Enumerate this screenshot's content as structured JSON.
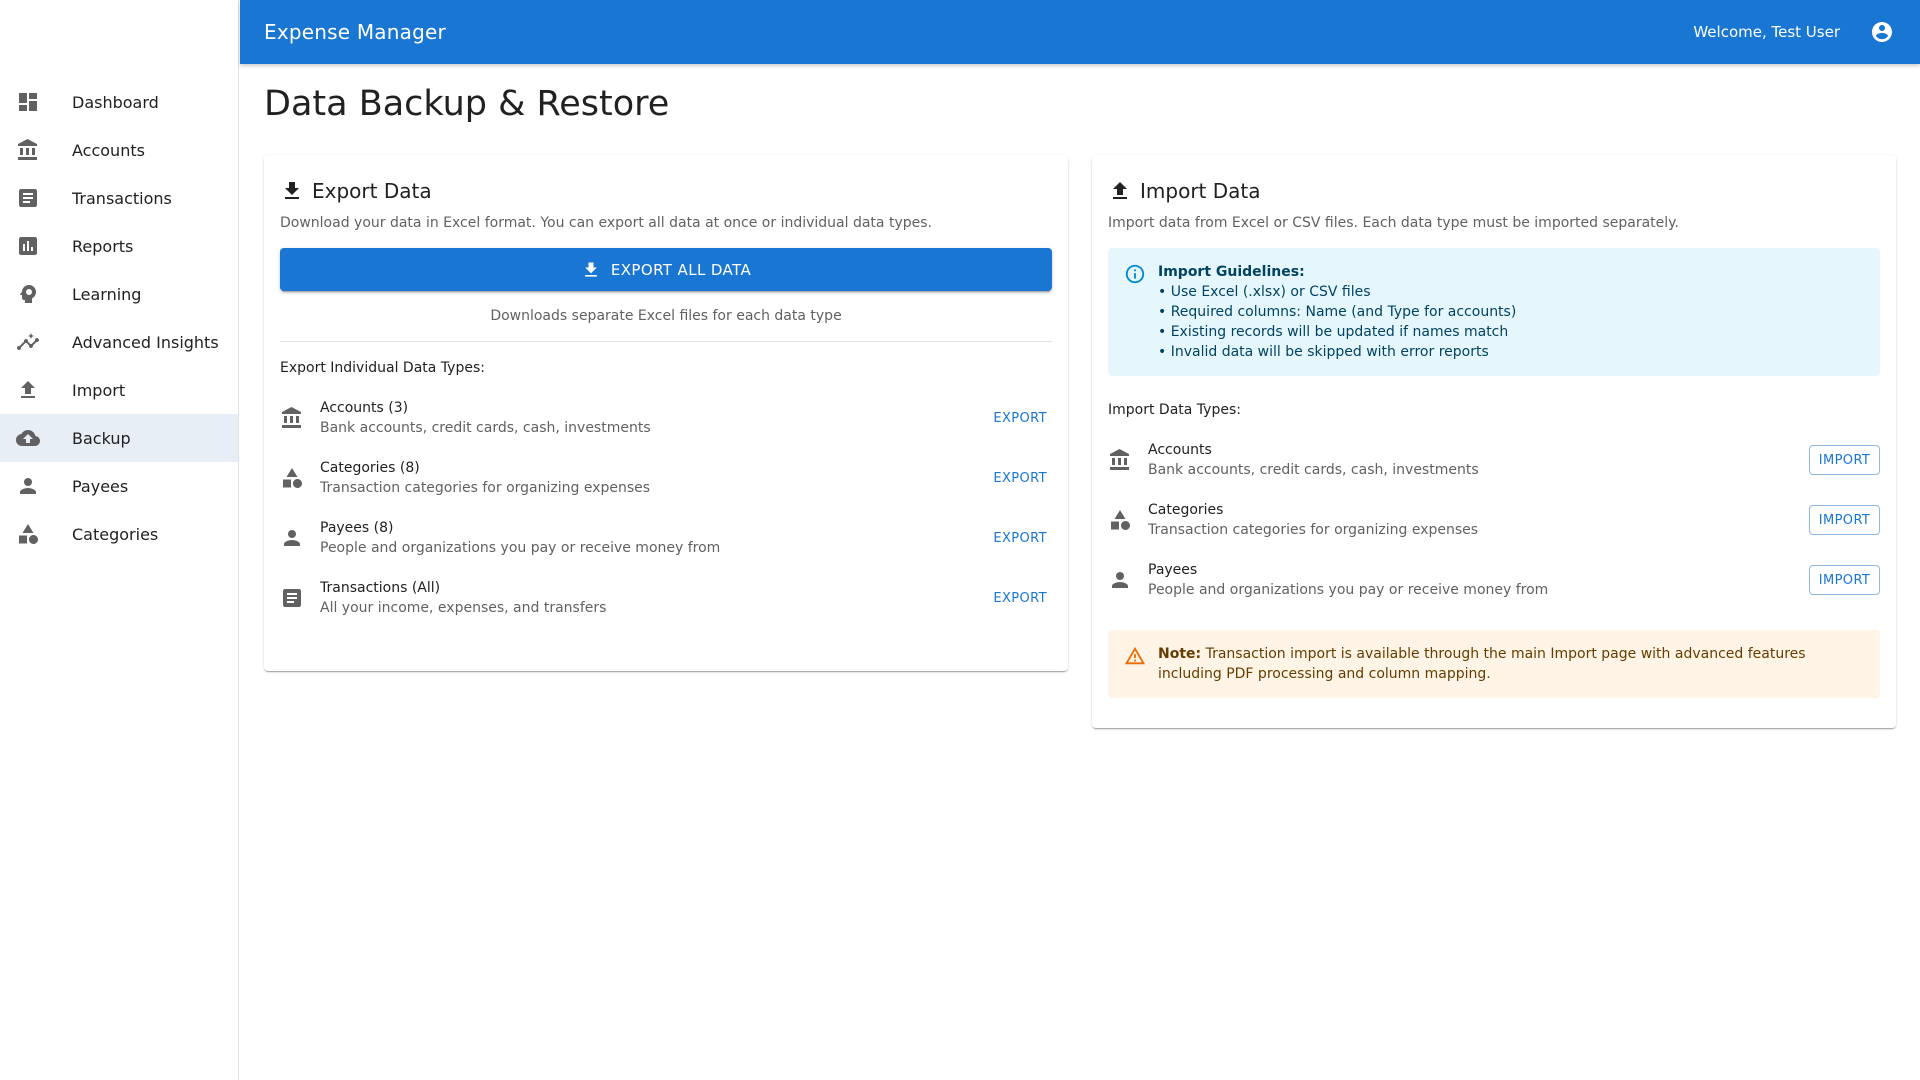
{
  "app": {
    "title": "Expense Manager",
    "welcome": "Welcome, Test User"
  },
  "sidebar": {
    "items": [
      {
        "label": "Dashboard",
        "icon": "dashboard-icon"
      },
      {
        "label": "Accounts",
        "icon": "bank-icon"
      },
      {
        "label": "Transactions",
        "icon": "receipt-icon"
      },
      {
        "label": "Reports",
        "icon": "assessment-icon"
      },
      {
        "label": "Learning",
        "icon": "psychology-icon"
      },
      {
        "label": "Advanced Insights",
        "icon": "insights-icon"
      },
      {
        "label": "Import",
        "icon": "upload-icon"
      },
      {
        "label": "Backup",
        "icon": "cloud-upload-icon",
        "selected": true
      },
      {
        "label": "Payees",
        "icon": "person-icon"
      },
      {
        "label": "Categories",
        "icon": "category-icon"
      }
    ]
  },
  "page": {
    "title": "Data Backup & Restore"
  },
  "export": {
    "title": "Export Data",
    "description": "Download your data in Excel format. You can export all data at once or individual data types.",
    "export_all_label": "EXPORT ALL DATA",
    "export_all_caption": "Downloads separate Excel files for each data type",
    "section_label": "Export Individual Data Types:",
    "button_label": "EXPORT",
    "items": [
      {
        "title": "Accounts (3)",
        "subtitle": "Bank accounts, credit cards, cash, investments",
        "icon": "bank-icon"
      },
      {
        "title": "Categories (8)",
        "subtitle": "Transaction categories for organizing expenses",
        "icon": "category-icon"
      },
      {
        "title": "Payees (8)",
        "subtitle": "People and organizations you pay or receive money from",
        "icon": "person-icon"
      },
      {
        "title": "Transactions (All)",
        "subtitle": "All your income, expenses, and transfers",
        "icon": "receipt-icon"
      }
    ]
  },
  "import": {
    "title": "Import Data",
    "description": "Import data from Excel or CSV files. Each data type must be imported separately.",
    "guidelines_title": "Import Guidelines:",
    "guidelines": [
      "• Use Excel (.xlsx) or CSV files",
      "• Required columns: Name (and Type for accounts)",
      "• Existing records will be updated if names match",
      "• Invalid data will be skipped with error reports"
    ],
    "section_label": "Import Data Types:",
    "button_label": "IMPORT",
    "items": [
      {
        "title": "Accounts",
        "subtitle": "Bank accounts, credit cards, cash, investments",
        "icon": "bank-icon"
      },
      {
        "title": "Categories",
        "subtitle": "Transaction categories for organizing expenses",
        "icon": "category-icon"
      },
      {
        "title": "Payees",
        "subtitle": "People and organizations you pay or receive money from",
        "icon": "person-icon"
      }
    ],
    "note_label": "Note:",
    "note_text": " Transaction import is available through the main Import page with advanced features including PDF processing and column mapping."
  },
  "colors": {
    "primary": "#1976d2",
    "info_bg": "#e5f6fd",
    "warning_bg": "#fff4e5",
    "selected_nav_bg": "#e8eef6"
  }
}
